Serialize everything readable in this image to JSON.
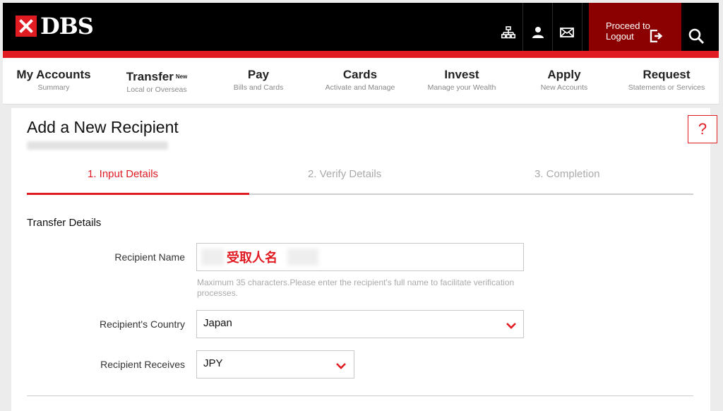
{
  "header": {
    "logo_text": "DBS",
    "logout_line1": "Proceed to",
    "logout_line2": "Logout",
    "icons": [
      "sitemap-icon",
      "user-icon",
      "mail-icon",
      "logout-icon",
      "search-icon"
    ]
  },
  "nav": {
    "items": [
      {
        "title": "My Accounts",
        "sub": "Summary"
      },
      {
        "title": "Transfer",
        "badge": "New",
        "sub": "Local or Overseas"
      },
      {
        "title": "Pay",
        "sub": "Bills and Cards"
      },
      {
        "title": "Cards",
        "sub": "Activate and Manage"
      },
      {
        "title": "Invest",
        "sub": "Manage your Wealth"
      },
      {
        "title": "Apply",
        "sub": "New Accounts"
      },
      {
        "title": "Request",
        "sub": "Statements or Services"
      }
    ]
  },
  "page": {
    "title": "Add a New Recipient",
    "help_label": "?"
  },
  "steps": [
    {
      "label": "1. Input Details",
      "active": true
    },
    {
      "label": "2. Verify Details",
      "active": false
    },
    {
      "label": "3. Completion",
      "active": false
    }
  ],
  "form": {
    "section_title": "Transfer Details",
    "recipient_name": {
      "label": "Recipient Name",
      "value": "受取人名"
    },
    "hint": "Maximum 35 characters.Please enter the recipient's full name to facilitate verification processes.",
    "country": {
      "label": "Recipient's Country",
      "value": "Japan"
    },
    "currency": {
      "label": "Recipient Receives",
      "value": "JPY"
    }
  },
  "colors": {
    "brand_red": "#e01b22",
    "logout_bg": "#8b0000",
    "header_bg": "#000000"
  }
}
